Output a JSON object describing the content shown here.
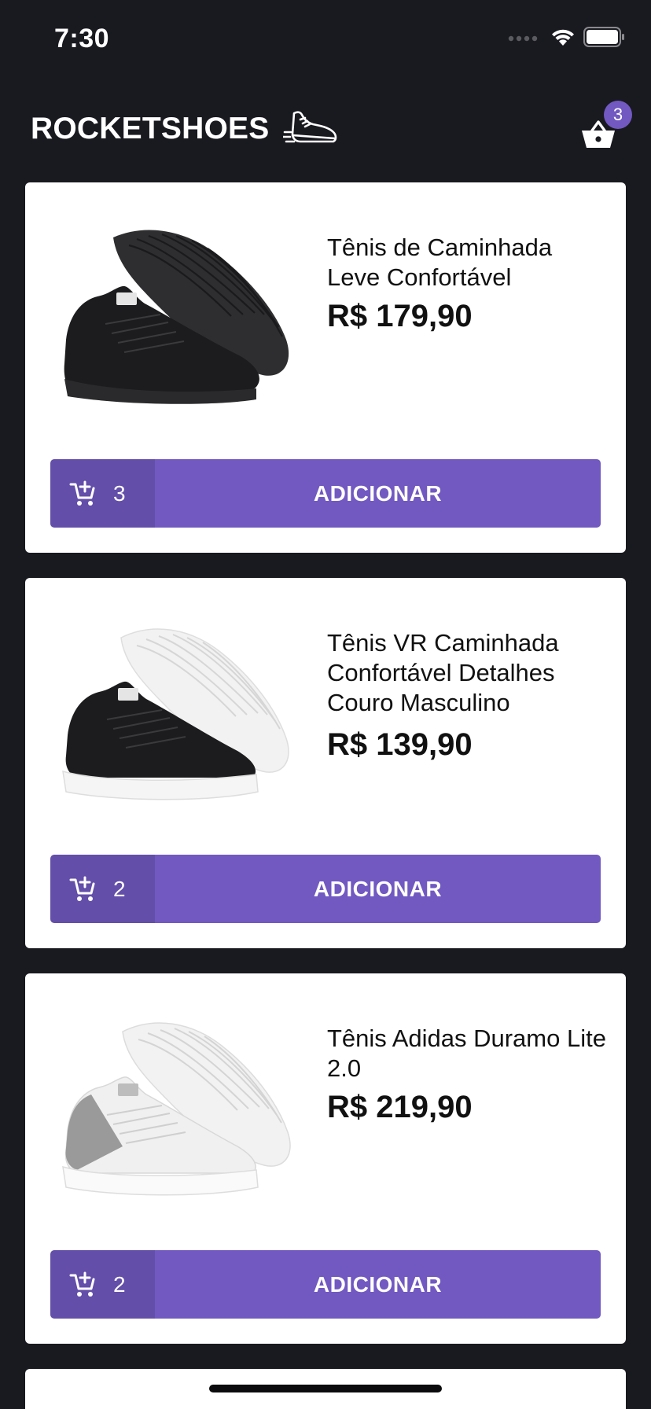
{
  "status_bar": {
    "time": "7:30"
  },
  "header": {
    "logo_text": "ROCKETSHOES",
    "cart_count": "3"
  },
  "colors": {
    "background": "#191920",
    "accent": "#7159c1",
    "card": "#ffffff"
  },
  "products": [
    {
      "title": "Tênis de Caminhada Leve Confortável",
      "price": "R$ 179,90",
      "amount": "3",
      "button_label": "ADICIONAR",
      "shoe_style": "all-black"
    },
    {
      "title": "Tênis VR Caminhada Confortável Detalhes Couro Masculino",
      "price": "R$ 139,90",
      "amount": "2",
      "button_label": "ADICIONAR",
      "shoe_style": "black-white-sole"
    },
    {
      "title": "Tênis Adidas Duramo Lite 2.0",
      "price": "R$ 219,90",
      "amount": "2",
      "button_label": "ADICIONAR",
      "shoe_style": "white-grey"
    }
  ],
  "icons": {
    "cart": "basket-icon",
    "add_to_cart": "cart-plus-icon",
    "logo": "sneaker-icon"
  }
}
